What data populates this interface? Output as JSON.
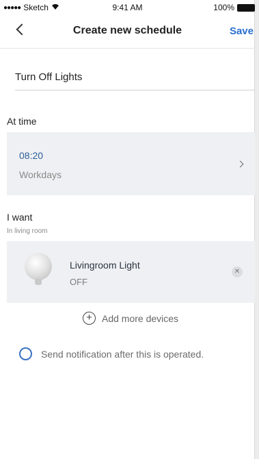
{
  "status_bar": {
    "carrier": "Sketch",
    "time": "9:41 AM",
    "battery": "100%"
  },
  "nav": {
    "title": "Create new schedule",
    "save_label": "Save"
  },
  "schedule_name": "Turn Off Lights",
  "time_section": {
    "label": "At time",
    "time": "08:20",
    "repeat": "Workdays"
  },
  "action_section": {
    "label": "I want",
    "sublabel": "In living room",
    "devices": [
      {
        "name": "Livingroom Light",
        "state": "OFF"
      }
    ],
    "add_label": "Add more devices"
  },
  "notification": {
    "label": "Send notification after this is operated.",
    "checked": false
  },
  "colors": {
    "accent": "#2a6fd0",
    "row_background": "#eef0f3"
  }
}
